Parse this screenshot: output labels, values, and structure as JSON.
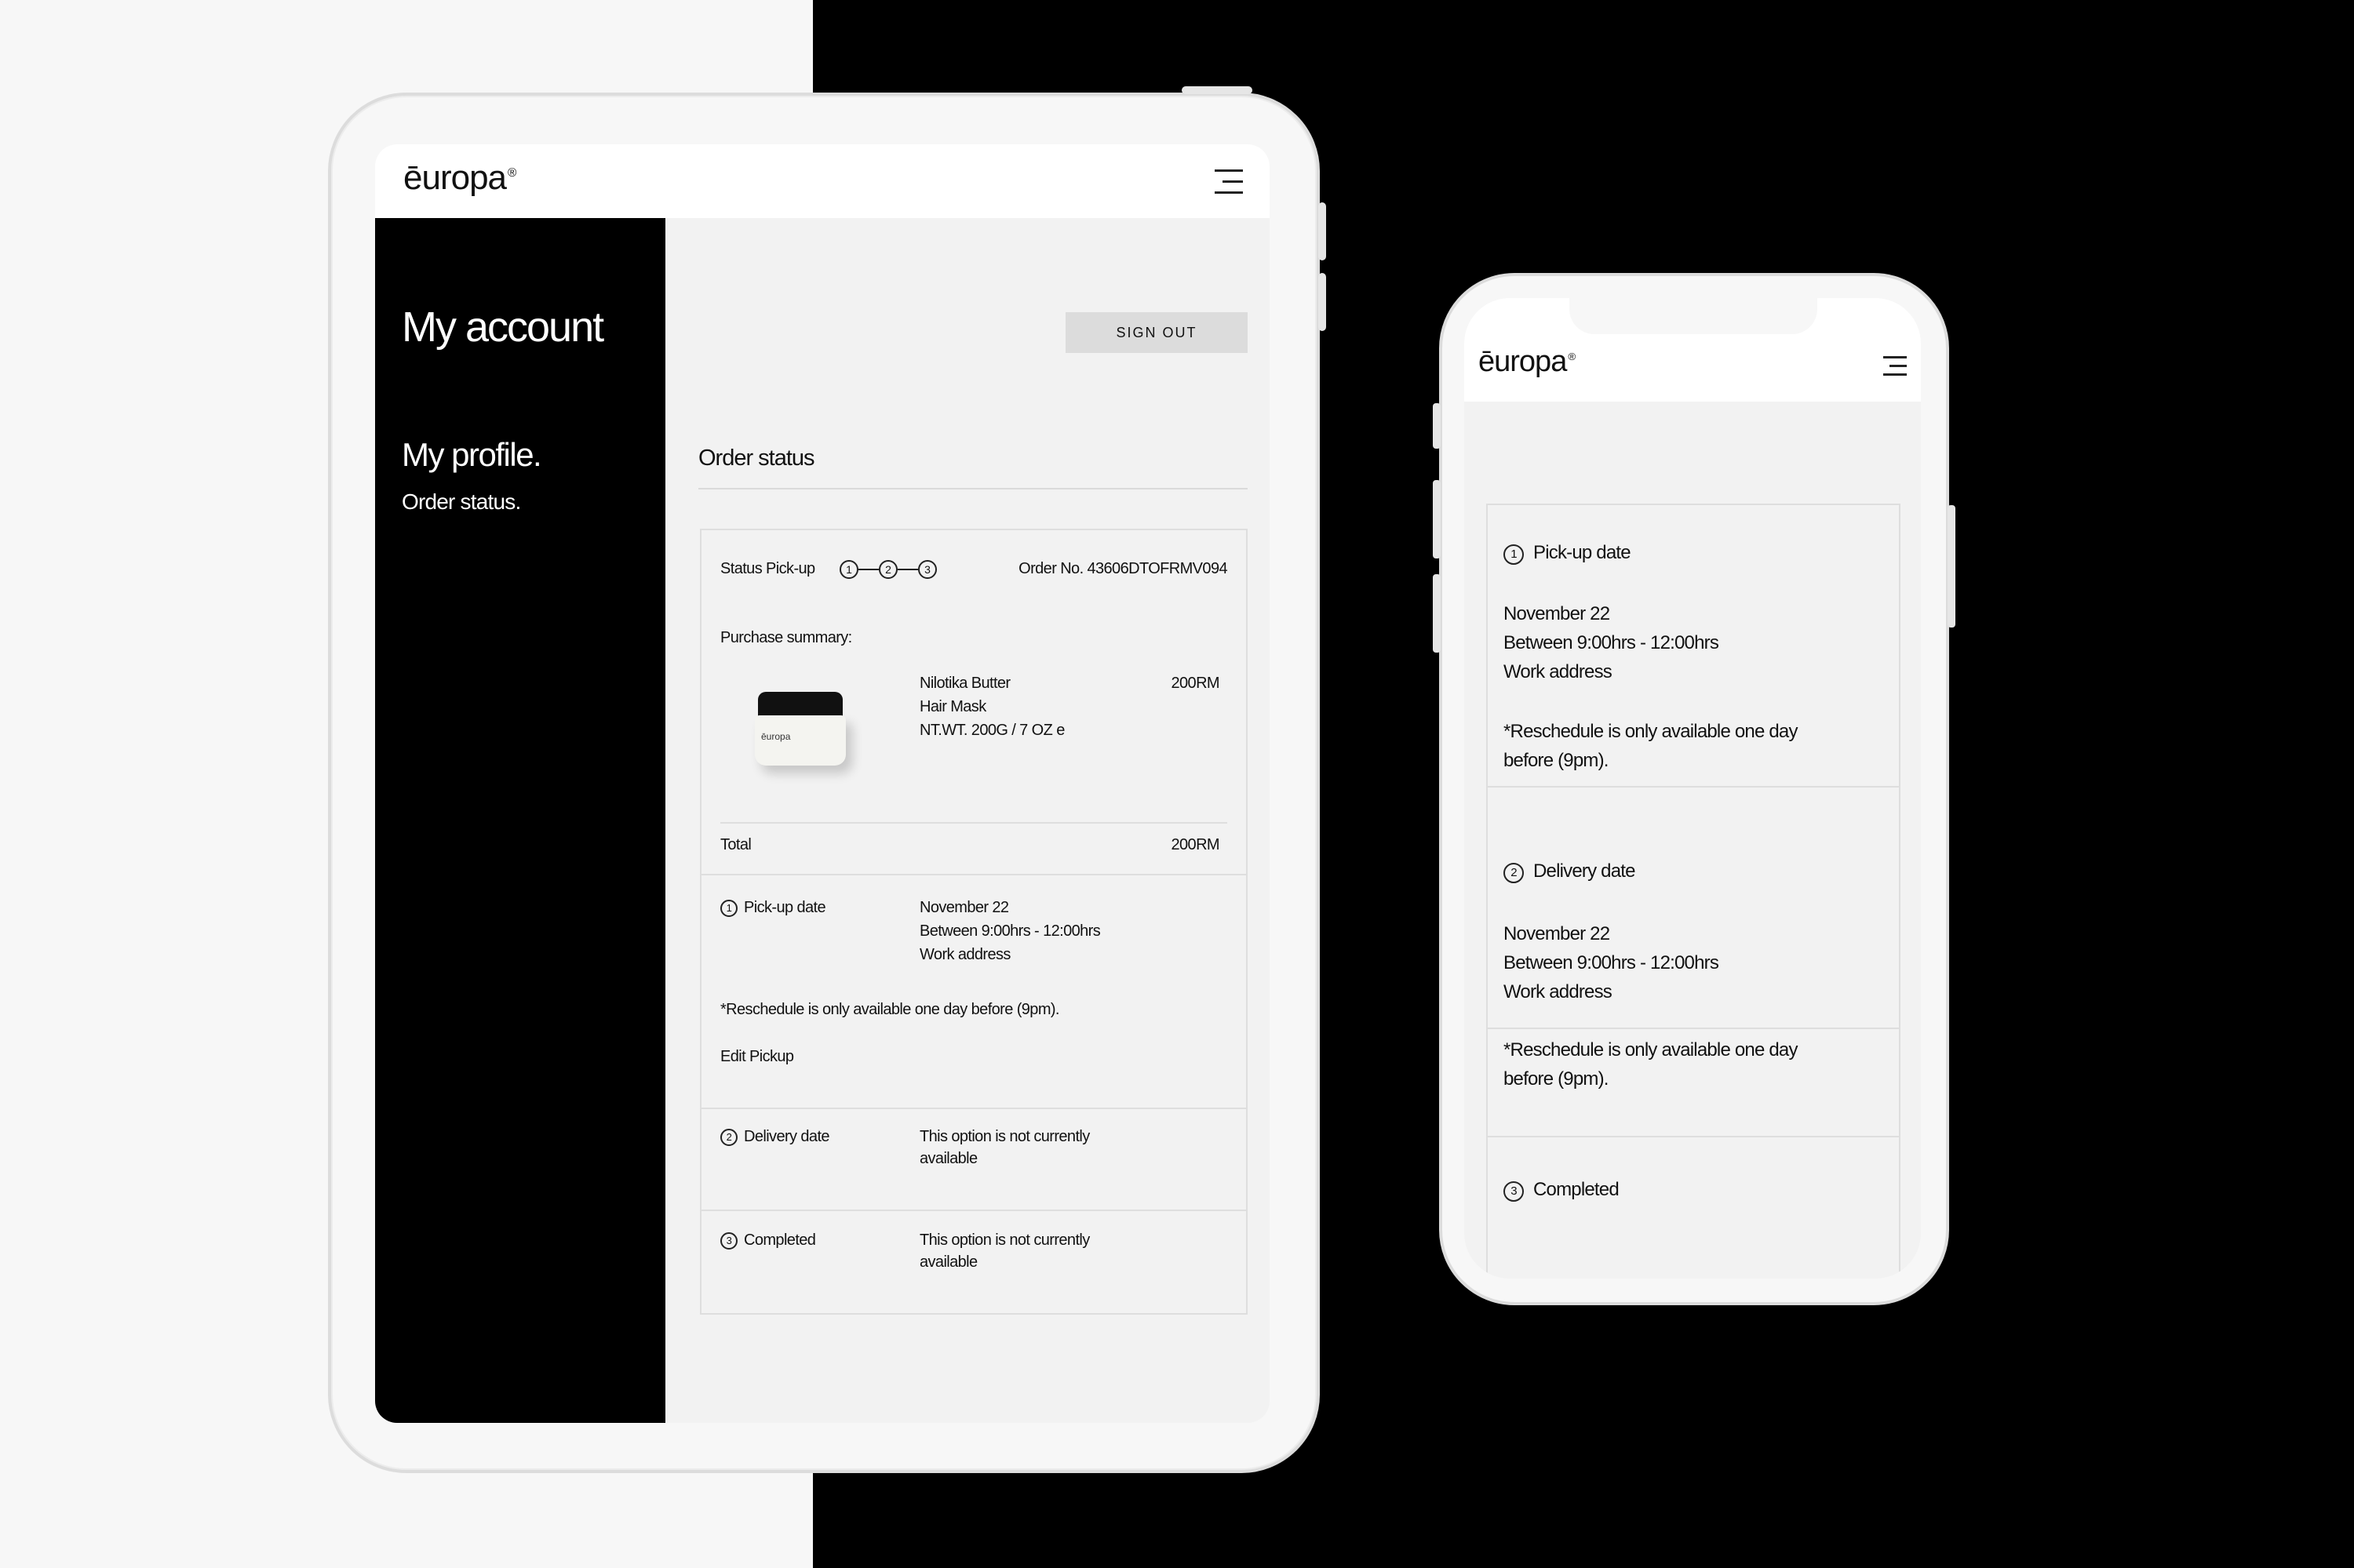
{
  "brand": {
    "logo": "ēuropa",
    "reg_mark": "®"
  },
  "tablet": {
    "sidebar": {
      "title": "My account",
      "nav": [
        "My profile.",
        "Order status."
      ]
    },
    "sign_out_label": "SIGN OUT",
    "section_title": "Order status",
    "order": {
      "status_label": "Status Pick-up",
      "steps": [
        "1",
        "2",
        "3"
      ],
      "order_no": "Order No. 43606DTOFRMV094",
      "summary_label": "Purchase summary:",
      "item": {
        "name_line1": "Nilotika Butter",
        "name_line2": "Hair Mask",
        "weight": "NT.WT. 200G / 7 OZ e",
        "price": "200RM",
        "jar_label": "ēuropa"
      },
      "total_label": "Total",
      "total_value": "200RM",
      "pickup": {
        "num": "1",
        "label": "Pick-up date",
        "date": "November 22",
        "time": "Between 9:00hrs - 12:00hrs",
        "address": "Work address",
        "note": "*Reschedule is only available one day before (9pm).",
        "edit": "Edit Pickup"
      },
      "delivery": {
        "num": "2",
        "label": "Delivery date",
        "status_line1": "This option is not currently",
        "status_line2": "available"
      },
      "completed": {
        "num": "3",
        "label": "Completed",
        "status_line1": "This option is not currently",
        "status_line2": "available"
      }
    }
  },
  "phone": {
    "pickup": {
      "num": "1",
      "label": "Pick-up date",
      "date": "November 22",
      "time": "Between 9:00hrs - 12:00hrs",
      "address": "Work address",
      "note_line1": "*Reschedule is only available one day",
      "note_line2": "before (9pm)."
    },
    "delivery": {
      "num": "2",
      "label": "Delivery date",
      "date": "November 22",
      "time": "Between 9:00hrs - 12:00hrs",
      "address": "Work address",
      "note_line1": "*Reschedule is only available one day",
      "note_line2": "before (9pm)."
    },
    "completed": {
      "num": "3",
      "label": "Completed"
    }
  }
}
